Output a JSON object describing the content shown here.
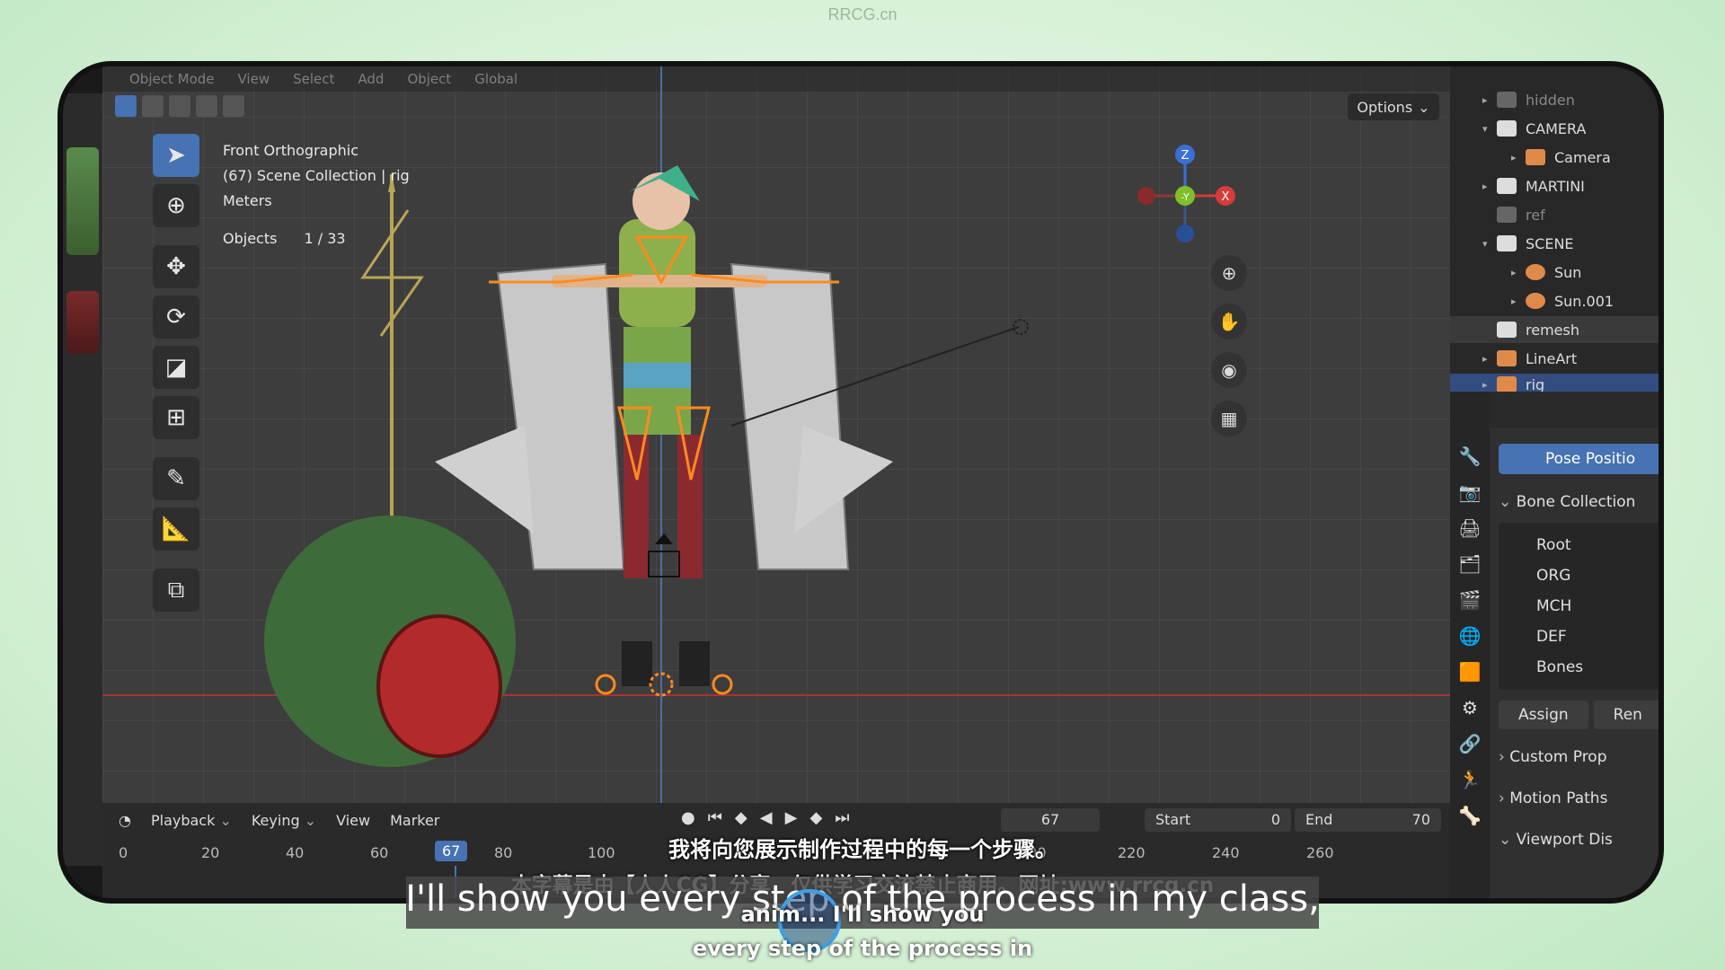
{
  "watermark": "RRCG.cn",
  "viewport": {
    "header_items": [
      "Object Mode",
      "View",
      "Select",
      "Add",
      "Object",
      "Global"
    ],
    "options_label": "Options",
    "info_view": "Front Orthographic",
    "info_collection": "(67) Scene Collection | rig",
    "info_units": "Meters",
    "objects_label": "Objects",
    "objects_value": "1 / 33"
  },
  "gizmo": {
    "z": "Z",
    "y": "-Y",
    "x": "X"
  },
  "timeline": {
    "menu": [
      "Playback",
      "Keying",
      "View",
      "Marker"
    ],
    "current_frame": "67",
    "start_label": "Start",
    "start_value": "0",
    "end_label": "End",
    "end_value": "70",
    "ruler": [
      "0",
      "20",
      "40",
      "60",
      "67",
      "80",
      "100",
      "200",
      "220",
      "240",
      "260"
    ]
  },
  "outliner": {
    "rows": [
      {
        "label": "hidden"
      },
      {
        "label": "CAMERA"
      },
      {
        "label": "Camera"
      },
      {
        "label": "MARTINI"
      },
      {
        "label": "ref"
      },
      {
        "label": "SCENE"
      },
      {
        "label": "Sun"
      },
      {
        "label": "Sun.001"
      },
      {
        "label": "remesh"
      },
      {
        "label": "LineArt"
      },
      {
        "label": "rig"
      }
    ]
  },
  "properties": {
    "pose_position": "Pose Positio",
    "bone_collections": "Bone Collection",
    "collections": [
      "Root",
      "ORG",
      "MCH",
      "DEF",
      "Bones"
    ],
    "assign": "Assign",
    "remove": "Ren",
    "custom_props": "Custom Prop",
    "motion_paths": "Motion Paths",
    "viewport_display": "Viewport Dis"
  },
  "subtitles": {
    "cn_line1": "我将向您展示制作过程中的每一个步骤。",
    "cn_line2": "本字幕是由【人人CG】分享，仅供学习交流禁止商用。网址:www.rrcg.cn",
    "en_line": "I'll show you every step of the process in my class,",
    "small_line1": "anim... I'll show you",
    "small_line2": "every step of the process in"
  }
}
